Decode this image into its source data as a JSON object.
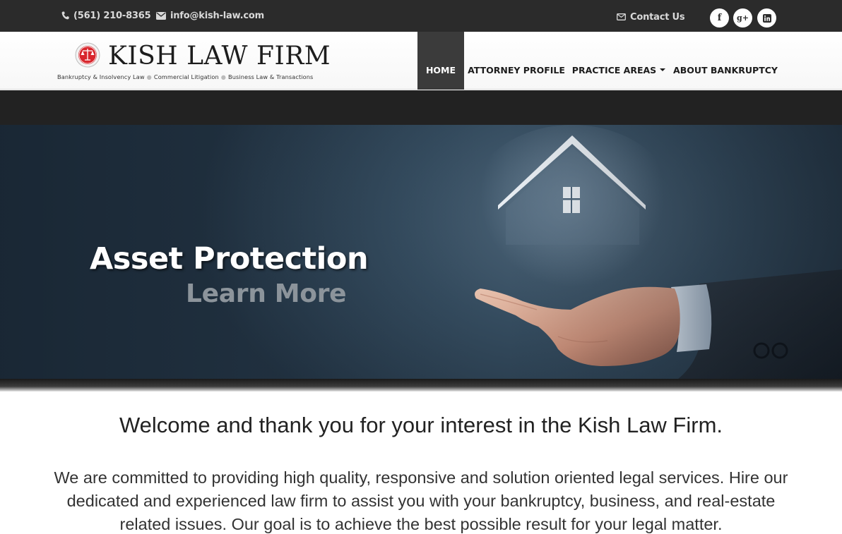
{
  "topbar": {
    "phone": "(561) 210-8365",
    "email": "info@kish-law.com",
    "contact_label": "Contact Us",
    "social": {
      "facebook": "f",
      "google_plus": "g+",
      "linkedin": "in"
    },
    "icons": {
      "phone": "phone-icon",
      "email": "envelope-icon",
      "contact": "envelope-outline-icon"
    }
  },
  "logo": {
    "name": "KISH LAW FIRM",
    "tagline": [
      "Bankruptcy & Insolvency Law",
      "Commercial Litigation",
      "Business Law & Transactions"
    ],
    "seal_color": "#d8262d"
  },
  "nav": {
    "items": [
      {
        "label": "HOME",
        "active": true
      },
      {
        "label": "ATTORNEY PROFILE"
      },
      {
        "label": "PRACTICE AREAS",
        "dropdown": true
      },
      {
        "label": "ABOUT BANKRUPTCY"
      }
    ]
  },
  "hero": {
    "title": "Asset Protection",
    "cta": "Learn More"
  },
  "main": {
    "welcome": "Welcome and thank you for your interest in the Kish Law Firm.",
    "intro": "We are committed to providing high quality, responsive and solution oriented legal services. Hire our dedicated and experienced law firm to assist you with your bankruptcy, business, and real-estate related issues. Our goal is to achieve the best possible result for your legal matter."
  },
  "colors": {
    "topbar": "#2b2b2b",
    "nav_active": "#3b3b3b",
    "band": "#222222",
    "hero": "#344b5e",
    "accent": "#d8262d"
  }
}
